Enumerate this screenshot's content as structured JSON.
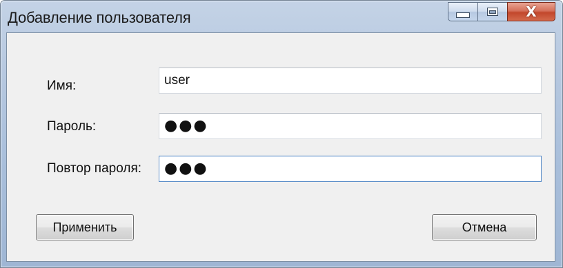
{
  "window": {
    "title": "Добавление пользователя"
  },
  "caption_buttons": {
    "minimize_icon": "minimize-icon",
    "maximize_icon": "maximize-icon",
    "close_icon": "close-icon",
    "close_glyph": "X"
  },
  "form": {
    "name_label": "Имя:",
    "name_value": "user",
    "password_label": "Пароль:",
    "password_value": "●●●",
    "repeat_label": "Повтор пароля:",
    "repeat_value": "●●●"
  },
  "buttons": {
    "apply_label": "Применить",
    "cancel_label": "Отмена"
  },
  "colors": {
    "close_button": "#c2472c",
    "focus_border": "#3b78bf",
    "client_background": "#f0f0f0"
  }
}
